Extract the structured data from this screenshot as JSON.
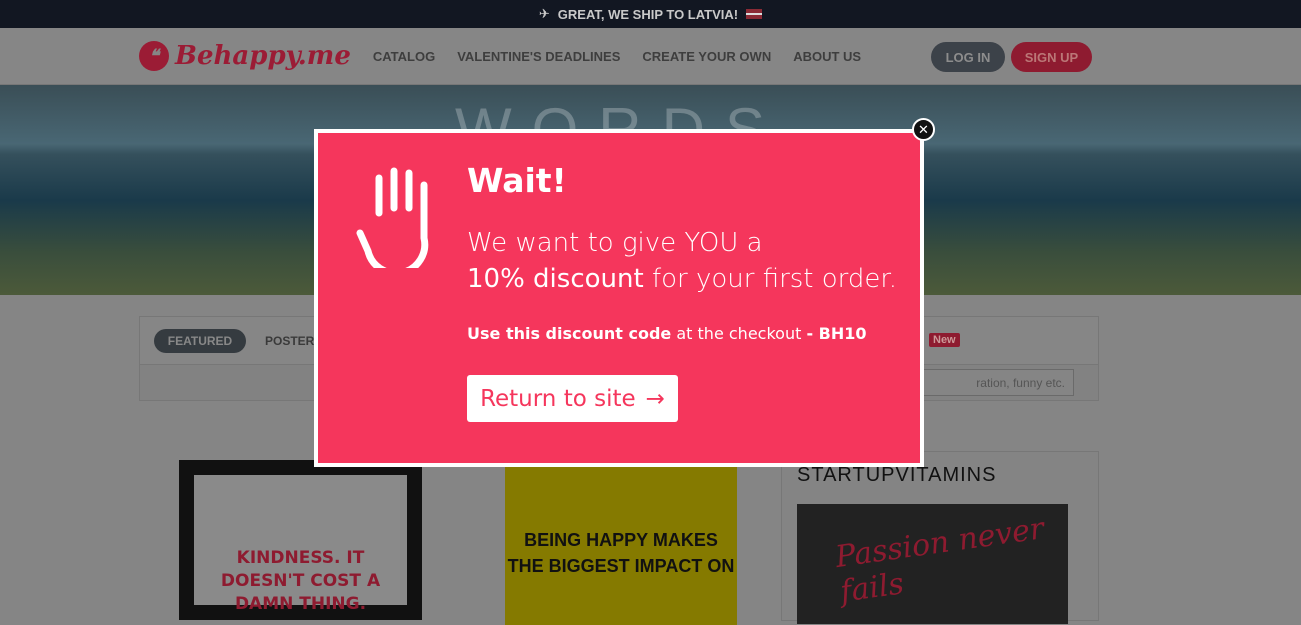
{
  "topbar": {
    "icon": "plane-icon",
    "text": "GREAT, WE SHIP TO LATVIA!"
  },
  "header": {
    "logo": "Behappy.me",
    "nav": [
      "CATALOG",
      "VALENTINE'S DEADLINES",
      "CREATE YOUR OWN",
      "ABOUT US"
    ],
    "login": "LOG IN",
    "signup": "SIGN UP"
  },
  "hero": {
    "watermark": "WORDS"
  },
  "filters": {
    "tabs": [
      "FEATURED",
      "POSTERS"
    ],
    "badge": "New",
    "search_placeholder": "ration, funny etc."
  },
  "products": {
    "p1": "KINDNESS. IT DOESN'T COST A DAMN THING.",
    "p2": "BEING HAPPY MAKES THE BIGGEST IMPACT ON",
    "p3_brand": "STARTUPVITAMINS",
    "p3_image": "Passion never fails"
  },
  "modal": {
    "title": "Wait!",
    "line1": "We want to give YOU a",
    "discount": "10% discount",
    "line2": " for your first order.",
    "code_bold": "Use this discount code",
    "code_mid": " at the checkout ",
    "code_val": "- BH10",
    "button": "Return to site",
    "close_icon": "close-icon",
    "hand_icon": "hand-icon",
    "accent": "#f5365c"
  }
}
